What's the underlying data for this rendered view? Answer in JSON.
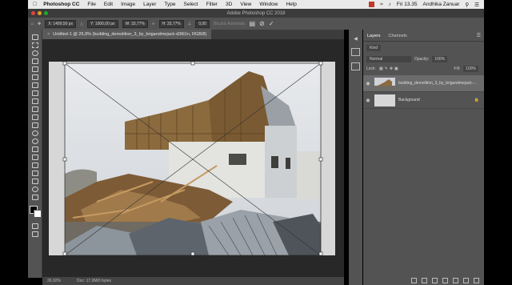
{
  "menubar": {
    "app": "Photoshop CC",
    "items": [
      "File",
      "Edit",
      "Image",
      "Layer",
      "Type",
      "Select",
      "Filter",
      "3D",
      "View",
      "Window",
      "Help"
    ],
    "clock": "Fri 13.35",
    "user": "Andhika Zanuar"
  },
  "window": {
    "title": "Adobe Photoshop CC 2018"
  },
  "options": {
    "x_value": "X: 1499,50 px",
    "y_value": "Y: 1000,00 px",
    "w_value": "W: 33,77%",
    "h_value": "H: 33,77%",
    "angle_value": "0,00",
    "interp": "Bicubic Automatic",
    "cancel_icon": "cancel-icon",
    "commit_icon": "check-icon"
  },
  "document": {
    "tab": "Untitled-1 @ 26,9% (building_demolition_3_by_brigandmejack-d36t1n, RGB/8)",
    "zoom": "26,92%",
    "doc_info": "Doc: 17,0M/0 bytes"
  },
  "panel": {
    "tabs": [
      "Layers",
      "Channels"
    ],
    "kind_label": "Kind",
    "blend_mode": "Normal",
    "opacity_label": "Opacity:",
    "opacity_value": "100%",
    "lock_label": "Lock:",
    "fill_label": "Fill:",
    "fill_value": "100%",
    "layers": [
      {
        "name": "building_demolition_3_by_brigandmejack-...",
        "selected": true
      },
      {
        "name": "Background",
        "selected": false
      }
    ]
  },
  "colors": {
    "accent": "#6b6b6b",
    "canvas_bg": "#d7d7d7",
    "workspace": "#282828"
  }
}
